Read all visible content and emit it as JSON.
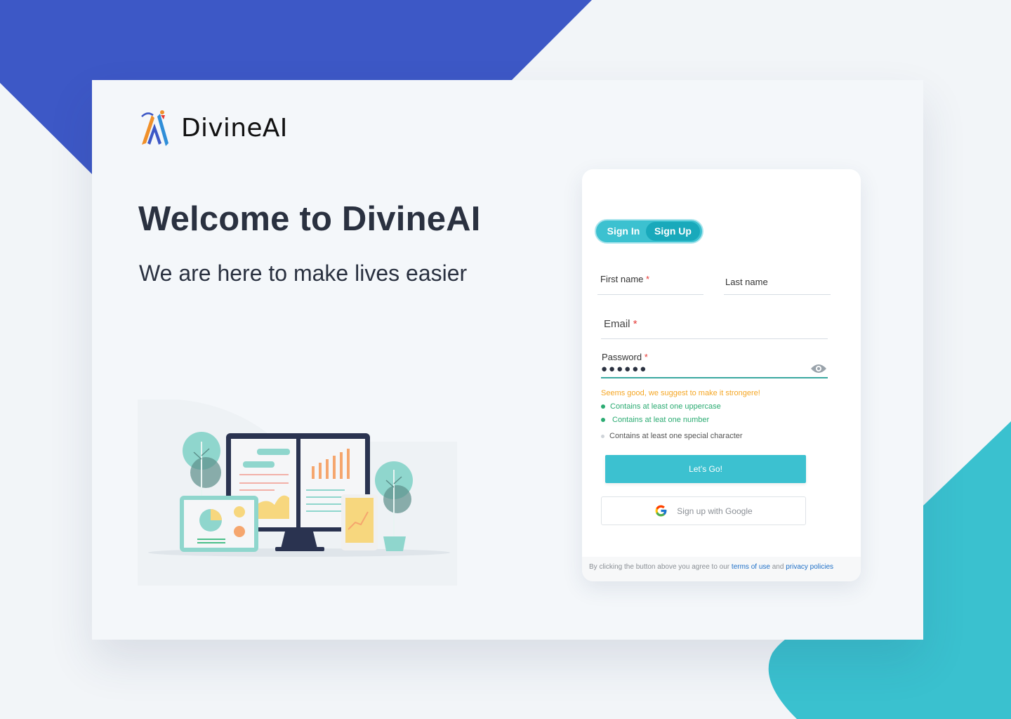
{
  "colors": {
    "background": "#f2f5f8",
    "indigo": "#3d58c6",
    "teal": "#3ac1cf",
    "primary_button": "#3cc1d0",
    "success": "#2bab72",
    "warning": "#f5a623",
    "link": "#1e6fc7"
  },
  "brand": {
    "logo_icon": "divineai-logo-icon",
    "name": "DivineAI"
  },
  "hero": {
    "title": "Welcome to DivineAI",
    "subtitle": "We are here to make lives easier",
    "illustration_icon": "analytics-dashboard-illustration"
  },
  "auth": {
    "tabs": {
      "sign_in": "Sign In",
      "sign_up": "Sign Up",
      "active": "Sign Up"
    },
    "fields": {
      "first_name": {
        "label": "First name",
        "required_mark": "*",
        "value": ""
      },
      "last_name": {
        "label": "Last name",
        "value": ""
      },
      "email": {
        "label": "Email",
        "required_mark": "*",
        "value": ""
      },
      "password": {
        "label": "Password",
        "required_mark": "*",
        "masked_value": "●●●●●●",
        "visibility_icon": "eye-icon"
      }
    },
    "strength_hint": "Seems good, we suggest to make it strongere!",
    "rules": [
      {
        "text": "Contains at least one uppercase",
        "met": true
      },
      {
        "text": "Contains at leat one number",
        "met": true
      },
      {
        "text": "Contains at least one special character",
        "met": false
      }
    ],
    "submit_label": "Let’s Go!",
    "google_label": "Sign up with Google",
    "google_icon": "google-icon",
    "legal": {
      "prefix": "By clicking the button above you agree to our",
      "terms": "terms of use",
      "and": "and",
      "privacy": "privacy policies"
    }
  }
}
